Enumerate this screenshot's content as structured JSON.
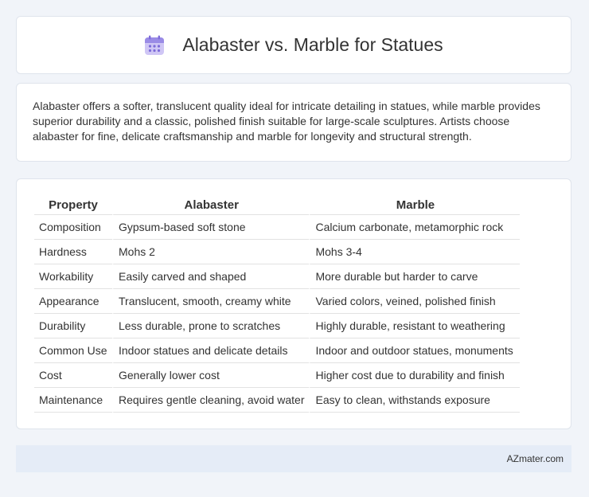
{
  "header": {
    "title": "Alabaster vs. Marble for Statues",
    "icon": "calendar-icon",
    "icon_color": "#9a8be6"
  },
  "summary": "Alabaster offers a softer, translucent quality ideal for intricate detailing in statues, while marble provides superior durability and a classic, polished finish suitable for large-scale sculptures. Artists choose alabaster for fine, delicate craftsmanship and marble for longevity and structural strength.",
  "table": {
    "headers": [
      "Property",
      "Alabaster",
      "Marble"
    ],
    "rows": [
      [
        "Composition",
        "Gypsum-based soft stone",
        "Calcium carbonate, metamorphic rock"
      ],
      [
        "Hardness",
        "Mohs 2",
        "Mohs 3-4"
      ],
      [
        "Workability",
        "Easily carved and shaped",
        "More durable but harder to carve"
      ],
      [
        "Appearance",
        "Translucent, smooth, creamy white",
        "Varied colors, veined, polished finish"
      ],
      [
        "Durability",
        "Less durable, prone to scratches",
        "Highly durable, resistant to weathering"
      ],
      [
        "Common Use",
        "Indoor statues and delicate details",
        "Indoor and outdoor statues, monuments"
      ],
      [
        "Cost",
        "Generally lower cost",
        "Higher cost due to durability and finish"
      ],
      [
        "Maintenance",
        "Requires gentle cleaning, avoid water",
        "Easy to clean, withstands exposure"
      ]
    ]
  },
  "footer": {
    "brand": "AZmater.com"
  },
  "colors": {
    "page_background": "#f1f4f9",
    "footer_background": "#e5ecf7"
  }
}
